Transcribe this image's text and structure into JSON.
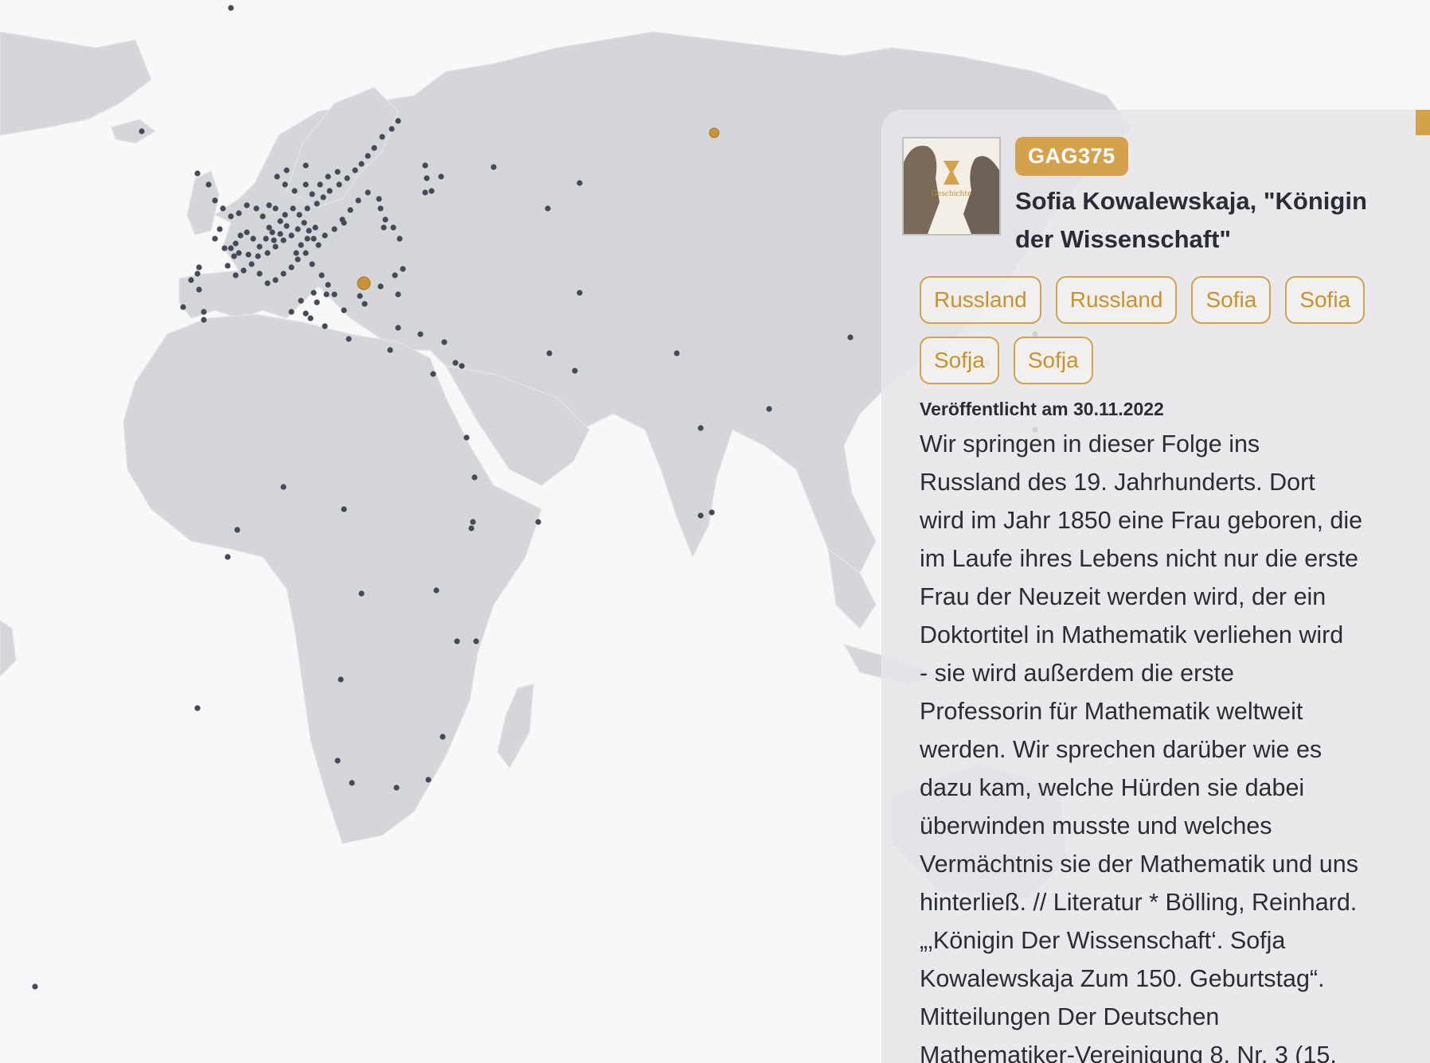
{
  "map": {
    "type": "world-map",
    "land_color": "#d5d6da",
    "background_color": "#f8f8f9",
    "marker_color": "#454a58",
    "highlight_color": "#c99335",
    "highlighted_places": [
      "Sofia",
      "Russland"
    ]
  },
  "episode": {
    "cover_icon": "podcast-cover-geschichte",
    "cover_text": "Geschichte",
    "code": "GAG375",
    "title": "Sofia Kowalewskaja, \"Königin der Wissenschaft\"",
    "tags": [
      "Russland",
      "Russland",
      "Sofia",
      "Sofia",
      "Sofja",
      "Sofja"
    ],
    "published": "Veröffentlicht am 30.11.2022",
    "description": "Wir springen in dieser Folge ins\nRussland des 19. Jahrhunderts. Dort\nwird im Jahr 1850 eine Frau geboren, die\nim Laufe ihres Lebens nicht nur die erste\nFrau der Neuzeit werden wird, der ein\nDoktortitel in Mathematik verliehen wird\n- sie wird außerdem die erste\nProfessorin für Mathematik weltweit\nwerden. Wir sprechen darüber wie es\ndazu kam, welche Hürden sie dabei\nüberwinden musste und welches\nVermächtnis sie der Mathematik und uns\nhinterließ. // Literatur * Bölling, Reinhard.\n„‚Königin Der Wissenschaft‘. Sofja\nKowalewskaja Zum 150. Geburtstag“.\nMitteilungen Der Deutschen\nMathematiker-Vereinigung 8, Nr. 3 (15.",
    "accent_color": "#d4a24c"
  }
}
